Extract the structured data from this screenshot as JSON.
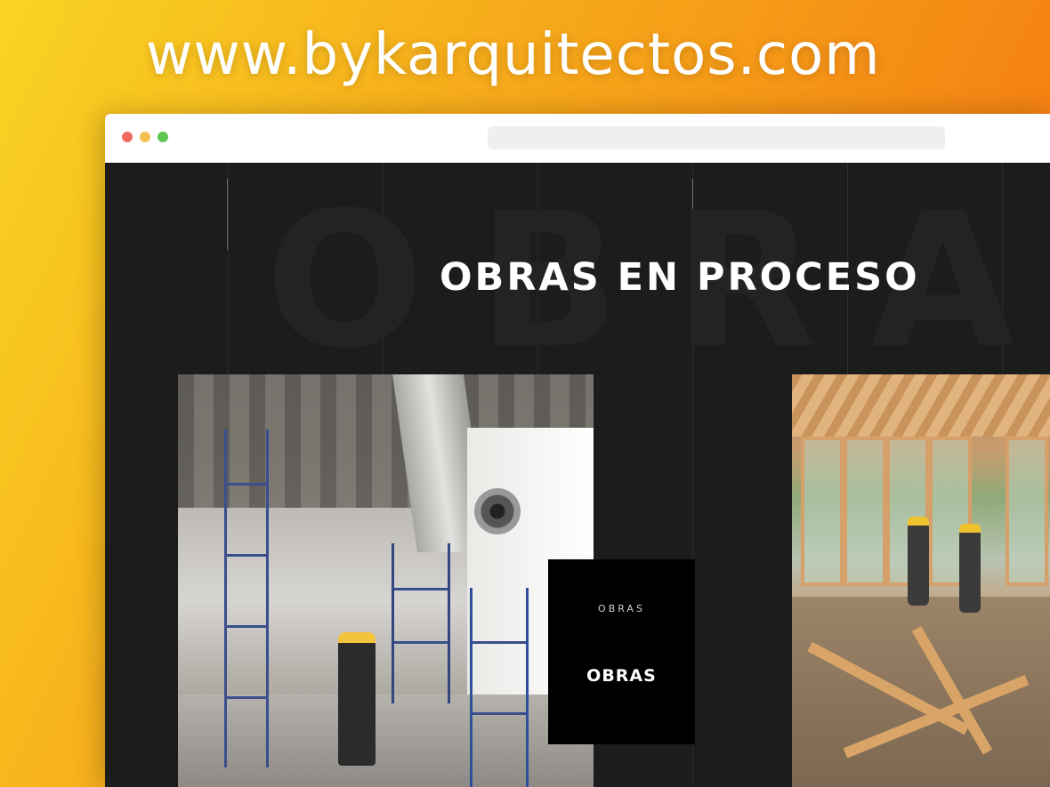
{
  "banner": {
    "url_text": "www.bykarquitectos.com"
  },
  "browser": {
    "window_controls": [
      "close",
      "minimize",
      "maximize"
    ],
    "address_bar_value": ""
  },
  "section": {
    "background_word": "OBRAS",
    "title": "OBRAS EN PROCESO"
  },
  "gallery": {
    "items": [
      {
        "photo": "construction-interior-scaffolding-photo"
      },
      {
        "photo": "timber-frame-construction-photo"
      }
    ],
    "overlay": {
      "category": "OBRAS",
      "title": "OBRAS"
    }
  },
  "colors": {
    "banner_gradient_start": "#f9d423",
    "banner_gradient_end": "#f26a0f",
    "page_background": "#1c1c1c",
    "card_background": "#000000",
    "title_color": "#ffffff"
  }
}
